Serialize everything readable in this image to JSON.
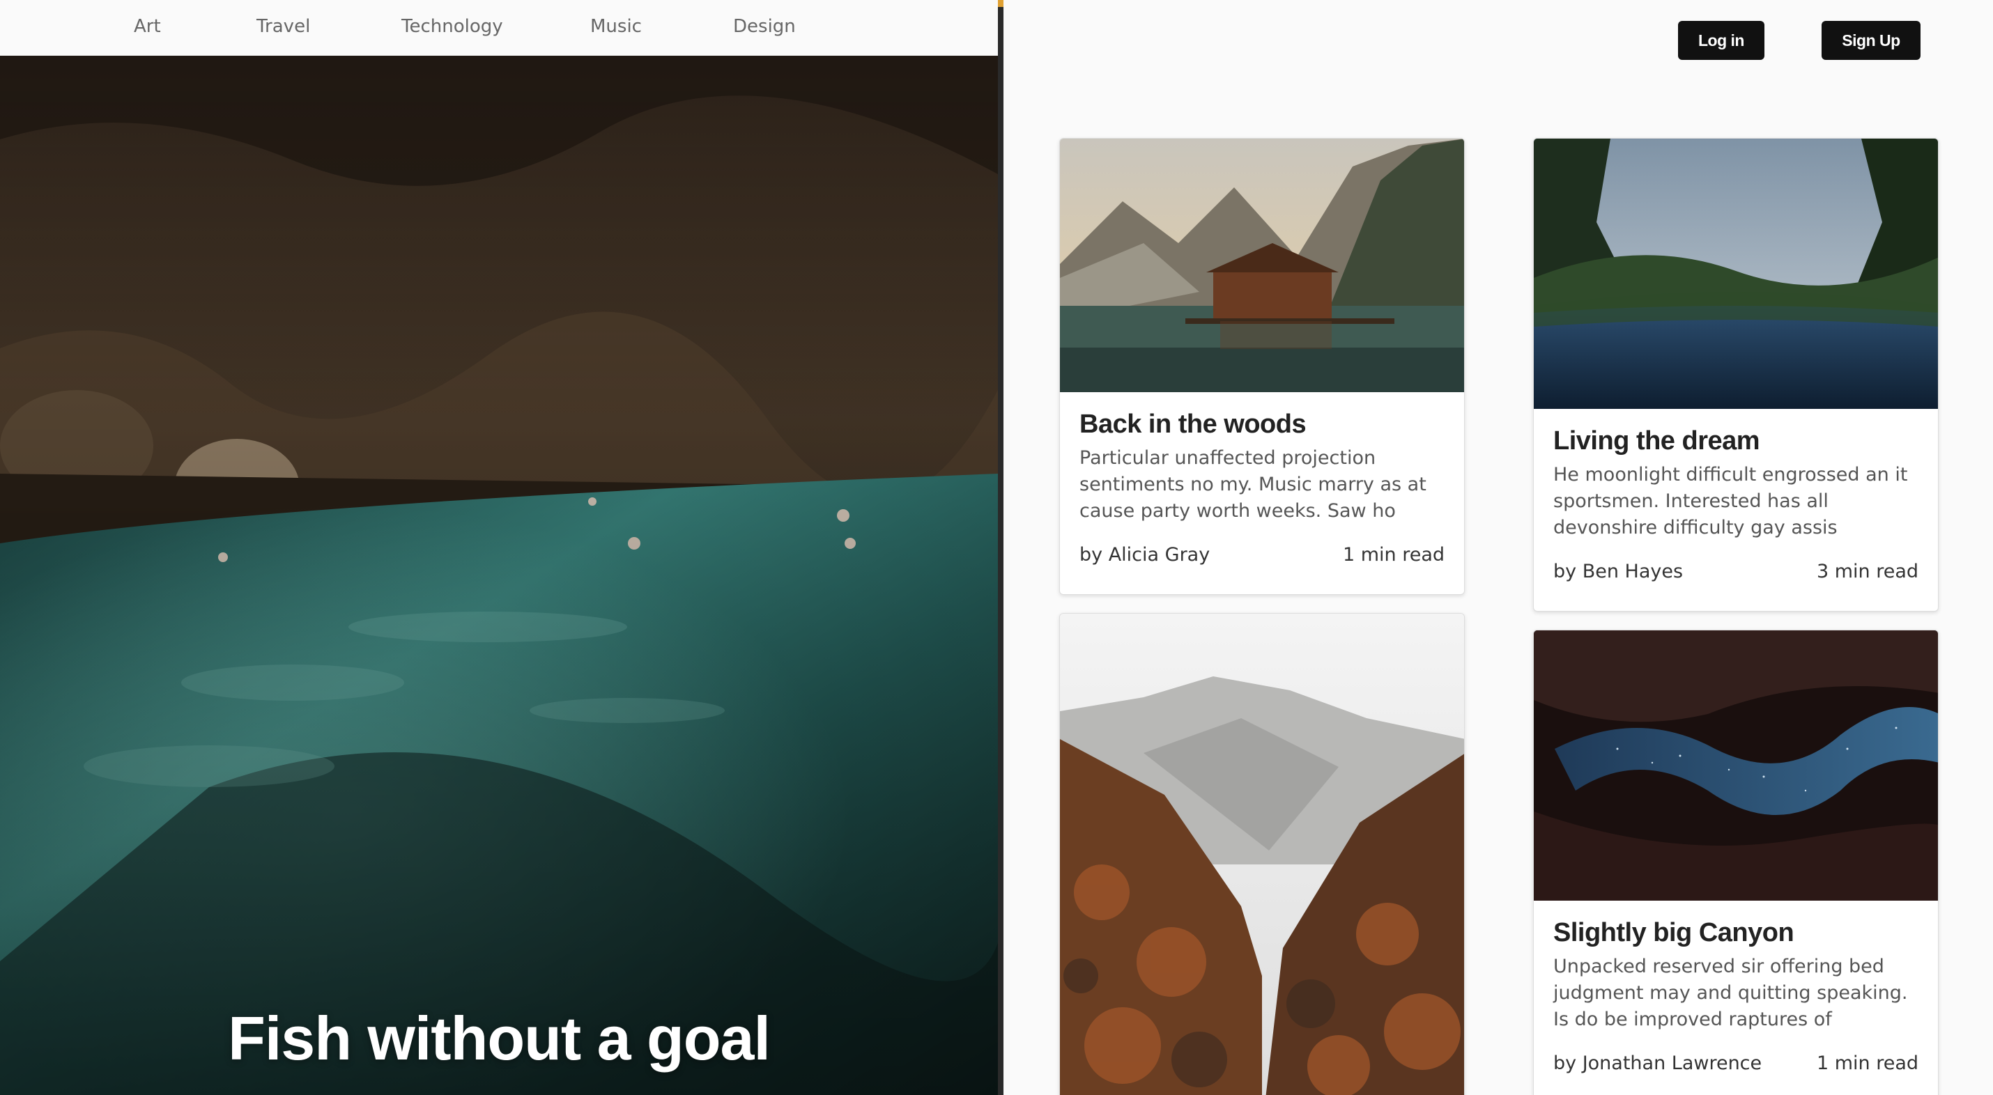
{
  "nav": {
    "items": [
      {
        "label": "Art",
        "name": "nav-item-art"
      },
      {
        "label": "Travel",
        "name": "nav-item-travel"
      },
      {
        "label": "Technology",
        "name": "nav-item-technology"
      },
      {
        "label": "Music",
        "name": "nav-item-music"
      },
      {
        "label": "Design",
        "name": "nav-item-design"
      }
    ]
  },
  "hero": {
    "title": "Fish without a goal"
  },
  "auth": {
    "login_label": "Log in",
    "signup_label": "Sign Up"
  },
  "cards": [
    {
      "title": "Back in the woods",
      "excerpt": "Particular unaffected projection sentiments no my. Music marry as at cause party worth weeks. Saw ho",
      "author": "by Alicia Gray",
      "read_time": "1 min read"
    },
    {
      "title": "Living the dream",
      "excerpt": "He moonlight difficult engrossed an it sportsmen. Interested has all devonshire difficulty gay assis",
      "author": "by Ben Hayes",
      "read_time": "3 min read"
    },
    {
      "title": "Slightly big Canyon",
      "excerpt": "Unpacked reserved sir offering bed judgment may and quitting speaking. Is do be improved raptures of",
      "author": "by Jonathan Lawrence",
      "read_time": "1 min read"
    }
  ],
  "colors": {
    "accent": "#e0a133",
    "button": "#111111",
    "background": "#fafafa"
  }
}
